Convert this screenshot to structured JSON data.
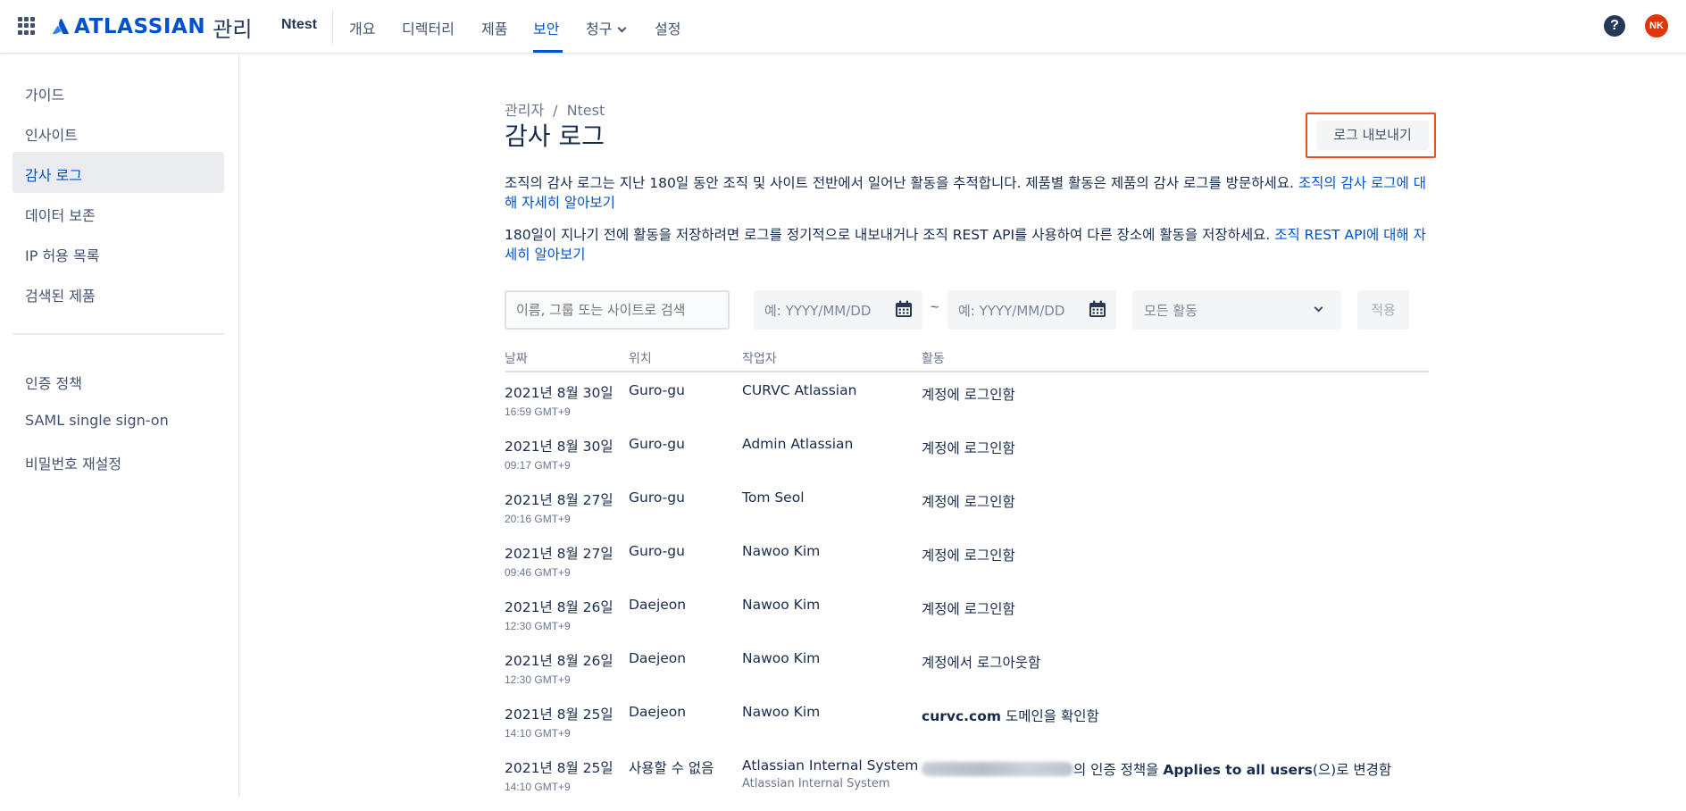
{
  "topnav": {
    "brand": "ATLASSIAN",
    "product": "관리",
    "org": "Ntest",
    "items": [
      {
        "label": "개요"
      },
      {
        "label": "디렉터리"
      },
      {
        "label": "제품"
      },
      {
        "label": "보안",
        "active": true
      },
      {
        "label": "청구",
        "has_dropdown": true
      },
      {
        "label": "설정"
      }
    ],
    "help_glyph": "?",
    "avatar_initials": "NK",
    "avatar_color": "#DE350B",
    "accent_color": "#0052CC"
  },
  "sidebar": {
    "group1": [
      {
        "label": "가이드"
      },
      {
        "label": "인사이트"
      },
      {
        "label": "감사 로그",
        "active": true
      },
      {
        "label": "데이터 보존"
      },
      {
        "label": "IP 허용 목록"
      },
      {
        "label": "검색된 제품"
      }
    ],
    "group2": [
      {
        "label": "인증 정책"
      },
      {
        "label": "SAML single sign-on"
      },
      {
        "label": "비밀번호 재설정"
      }
    ]
  },
  "main": {
    "breadcrumb": [
      "관리자",
      "Ntest"
    ],
    "breadcrumb_sep": "/",
    "title": "감사 로그",
    "export_label": "로그 내보내기",
    "para1_text": "조직의 감사 로그는 지난 180일 동안 조직 및 사이트 전반에서 일어난 활동을 추적합니다. 제품별 활동은 제품의 감사 로그를 방문하세요. ",
    "para1_link": "조직의 감사 로그에 대해 자세히 알아보기",
    "para2_text": "180일이 지나기 전에 활동을 저장하려면 로그를 정기적으로 내보내거나 조직 REST API를 사용하여 다른 장소에 활동을 저장하세요. ",
    "para2_link": "조직 REST API에 대해 자세히 알아보기"
  },
  "filters": {
    "search_placeholder": "이름, 그룹 또는 사이트로 검색",
    "date_from_placeholder": "예: YYYY/MM/DD",
    "date_to_placeholder": "예: YYYY/MM/DD",
    "range_sep": "~",
    "activity_select": "모든 활동",
    "apply_label": "적용"
  },
  "table": {
    "columns": [
      "날짜",
      "위치",
      "작업자",
      "활동"
    ],
    "rows": [
      {
        "date": "2021년 8월 30일",
        "time": "16:59 GMT+9",
        "location": "Guro-gu",
        "actor": "CURVC Atlassian",
        "actor_sub": "",
        "activity": "계정에 로그인함"
      },
      {
        "date": "2021년 8월 30일",
        "time": "09:17 GMT+9",
        "location": "Guro-gu",
        "actor": "Admin Atlassian",
        "actor_sub": "",
        "activity": "계정에 로그인함"
      },
      {
        "date": "2021년 8월 27일",
        "time": "20:16 GMT+9",
        "location": "Guro-gu",
        "actor": "Tom Seol",
        "actor_sub": "",
        "activity": "계정에 로그인함"
      },
      {
        "date": "2021년 8월 27일",
        "time": "09:46 GMT+9",
        "location": "Guro-gu",
        "actor": "Nawoo Kim",
        "actor_sub": "",
        "activity": "계정에 로그인함"
      },
      {
        "date": "2021년 8월 26일",
        "time": "12:30 GMT+9",
        "location": "Daejeon",
        "actor": "Nawoo Kim",
        "actor_sub": "",
        "activity": "계정에 로그인함"
      },
      {
        "date": "2021년 8월 26일",
        "time": "12:30 GMT+9",
        "location": "Daejeon",
        "actor": "Nawoo Kim",
        "actor_sub": "",
        "activity": "계정에서 로그아웃함"
      },
      {
        "date": "2021년 8월 25일",
        "time": "14:10 GMT+9",
        "location": "Daejeon",
        "actor": "Nawoo Kim",
        "actor_sub": "",
        "activity_bold": "curvc.com",
        "activity": " 도메인을 확인함"
      },
      {
        "date": "2021년 8월 25일",
        "time": "14:10 GMT+9",
        "location": "사용할 수 없음",
        "actor": "Atlassian Internal System",
        "actor_sub": "Atlassian Internal System",
        "activity_redacted": true,
        "activity_pre": "의 인증 정책을 ",
        "activity_bold": "Applies to all users",
        "activity": "(으)로 변경함"
      }
    ]
  }
}
